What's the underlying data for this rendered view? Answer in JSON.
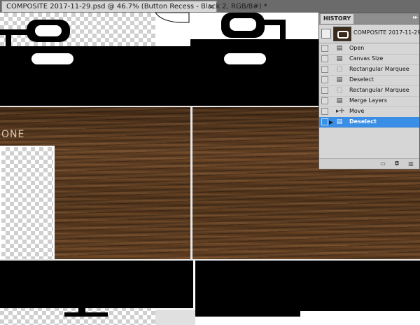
{
  "document_tab": {
    "title": "COMPOSITE 2017-11-29.psd @ 46.7% (Button Recess - Black 2, RGB/8#) *",
    "close_glyph": "×"
  },
  "canvas": {
    "visible_text": "ONE"
  },
  "history_panel": {
    "tab_label": "HISTORY",
    "menu_glyph": "▸▸",
    "snapshot_label": "COMPOSITE 2017-11-29....",
    "items": [
      {
        "label": "Open",
        "icon": "document-icon",
        "selected": false
      },
      {
        "label": "Canvas Size",
        "icon": "document-icon",
        "selected": false
      },
      {
        "label": "Rectangular Marquee",
        "icon": "marquee-icon",
        "selected": false
      },
      {
        "label": "Deselect",
        "icon": "document-icon",
        "selected": false
      },
      {
        "label": "Rectangular Marquee",
        "icon": "marquee-icon",
        "selected": false
      },
      {
        "label": "Merge Layers",
        "icon": "document-icon",
        "selected": false
      },
      {
        "label": "Move",
        "icon": "move-icon",
        "selected": false
      },
      {
        "label": "Deselect",
        "icon": "document-icon",
        "selected": true
      }
    ],
    "footer_buttons": [
      "new-document-from-state-icon",
      "camera-icon",
      "trash-icon"
    ],
    "selected_color": "#3a8ee6"
  }
}
